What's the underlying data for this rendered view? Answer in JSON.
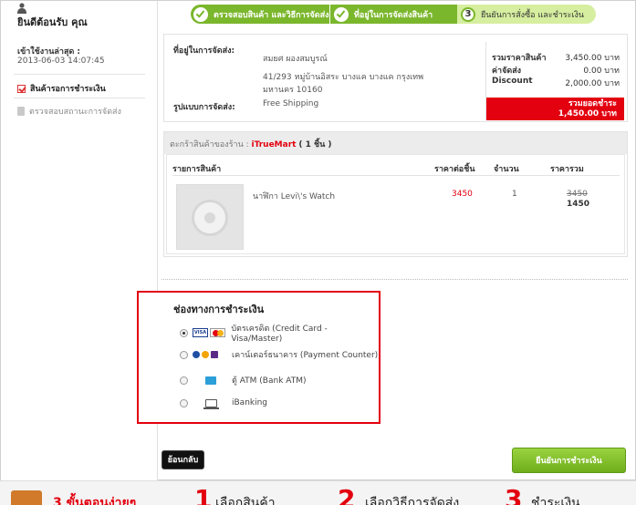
{
  "sidebar": {
    "welcome": "ยินดีต้อนรับ คุณ",
    "last_login_label": "เข้าใช้งานล่าสุด :",
    "last_login_time": "2013-06-03 14:07:45",
    "items": [
      {
        "label": "สินค้ารอการชำระเงิน",
        "icon": "checkbox-icon",
        "active": true
      },
      {
        "label": "ตรวจสอบสถานะการจัดส่ง",
        "icon": "document-icon",
        "active": false
      }
    ]
  },
  "steps": [
    {
      "label": "ตรวจสอบสินค้า และวิธีการจัดส่ง",
      "status": "done"
    },
    {
      "label": "ที่อยู่ในการจัดส่งสินค้า",
      "status": "done"
    },
    {
      "number": "3",
      "label": "ยืนยันการสั่งซื้อ และชำระเงิน",
      "status": "current"
    }
  ],
  "shipping": {
    "address_label": "ที่อยู่ในการจัดส่ง:",
    "name": "สมยศ ผองสมบูรณ์",
    "address_line1": "41/293 หมู่บ้านอิสระ บางแค บางแค กรุงเทพ",
    "address_line2": "มหานคร 10160",
    "method_label": "รูปแบบการจัดส่ง:",
    "method_value": "Free Shipping"
  },
  "totals": {
    "rows": [
      {
        "label": "รวมราคาสินค้า",
        "value": "3,450.00 บาท"
      },
      {
        "label": "ค่าจัดส่ง",
        "value": "0.00 บาท"
      },
      {
        "label": "Discount",
        "value": "2,000.00 บาท"
      }
    ],
    "grand_label": "รวมยอดชำระ",
    "grand_value": "1,450.00 บาท"
  },
  "cart": {
    "header_prefix": "ตะกร้าสินค้าของร้าน :",
    "store": "iTrueMart",
    "count": "( 1 ชิ้น )",
    "columns": [
      "รายการสินค้า",
      "ราคาต่อชิ้น",
      "จำนวน",
      "ราคารวม"
    ],
    "items": [
      {
        "name": "นาฬิกา Levi\\'s Watch",
        "unit_price": "3450",
        "qty": "1",
        "old_total": "3450",
        "new_total": "1450"
      }
    ]
  },
  "payment": {
    "title": "ช่องทางการชำระเงิน",
    "options": [
      {
        "label": "บัตรเครดิต (Credit Card - Visa/Master)",
        "selected": true,
        "icon": "credit-card-icon"
      },
      {
        "label": "เคาน์เตอร์ธนาคาร (Payment Counter)",
        "selected": false,
        "icon": "bank-counter-icon"
      },
      {
        "label": "ตู้ ATM (Bank ATM)",
        "selected": false,
        "icon": "atm-icon"
      },
      {
        "label": "iBanking",
        "selected": false,
        "icon": "computer-icon"
      }
    ],
    "visa_text": "VISA"
  },
  "buttons": {
    "back": "ย้อนกลับ",
    "confirm": "ยืนยันการชำระเงิน"
  },
  "banner": {
    "title": "3 ขั้นตอนง่ายๆ",
    "step1_num": "1",
    "step1_text": "เลือกสินค้า",
    "step2_num": "2",
    "step2_text": "เลือกวิธีการจัดส่ง",
    "step3_num": "3",
    "step3_text": "ชำระเงิน"
  },
  "colors": {
    "accent_green": "#7bb72c",
    "accent_red": "#e3000f"
  }
}
